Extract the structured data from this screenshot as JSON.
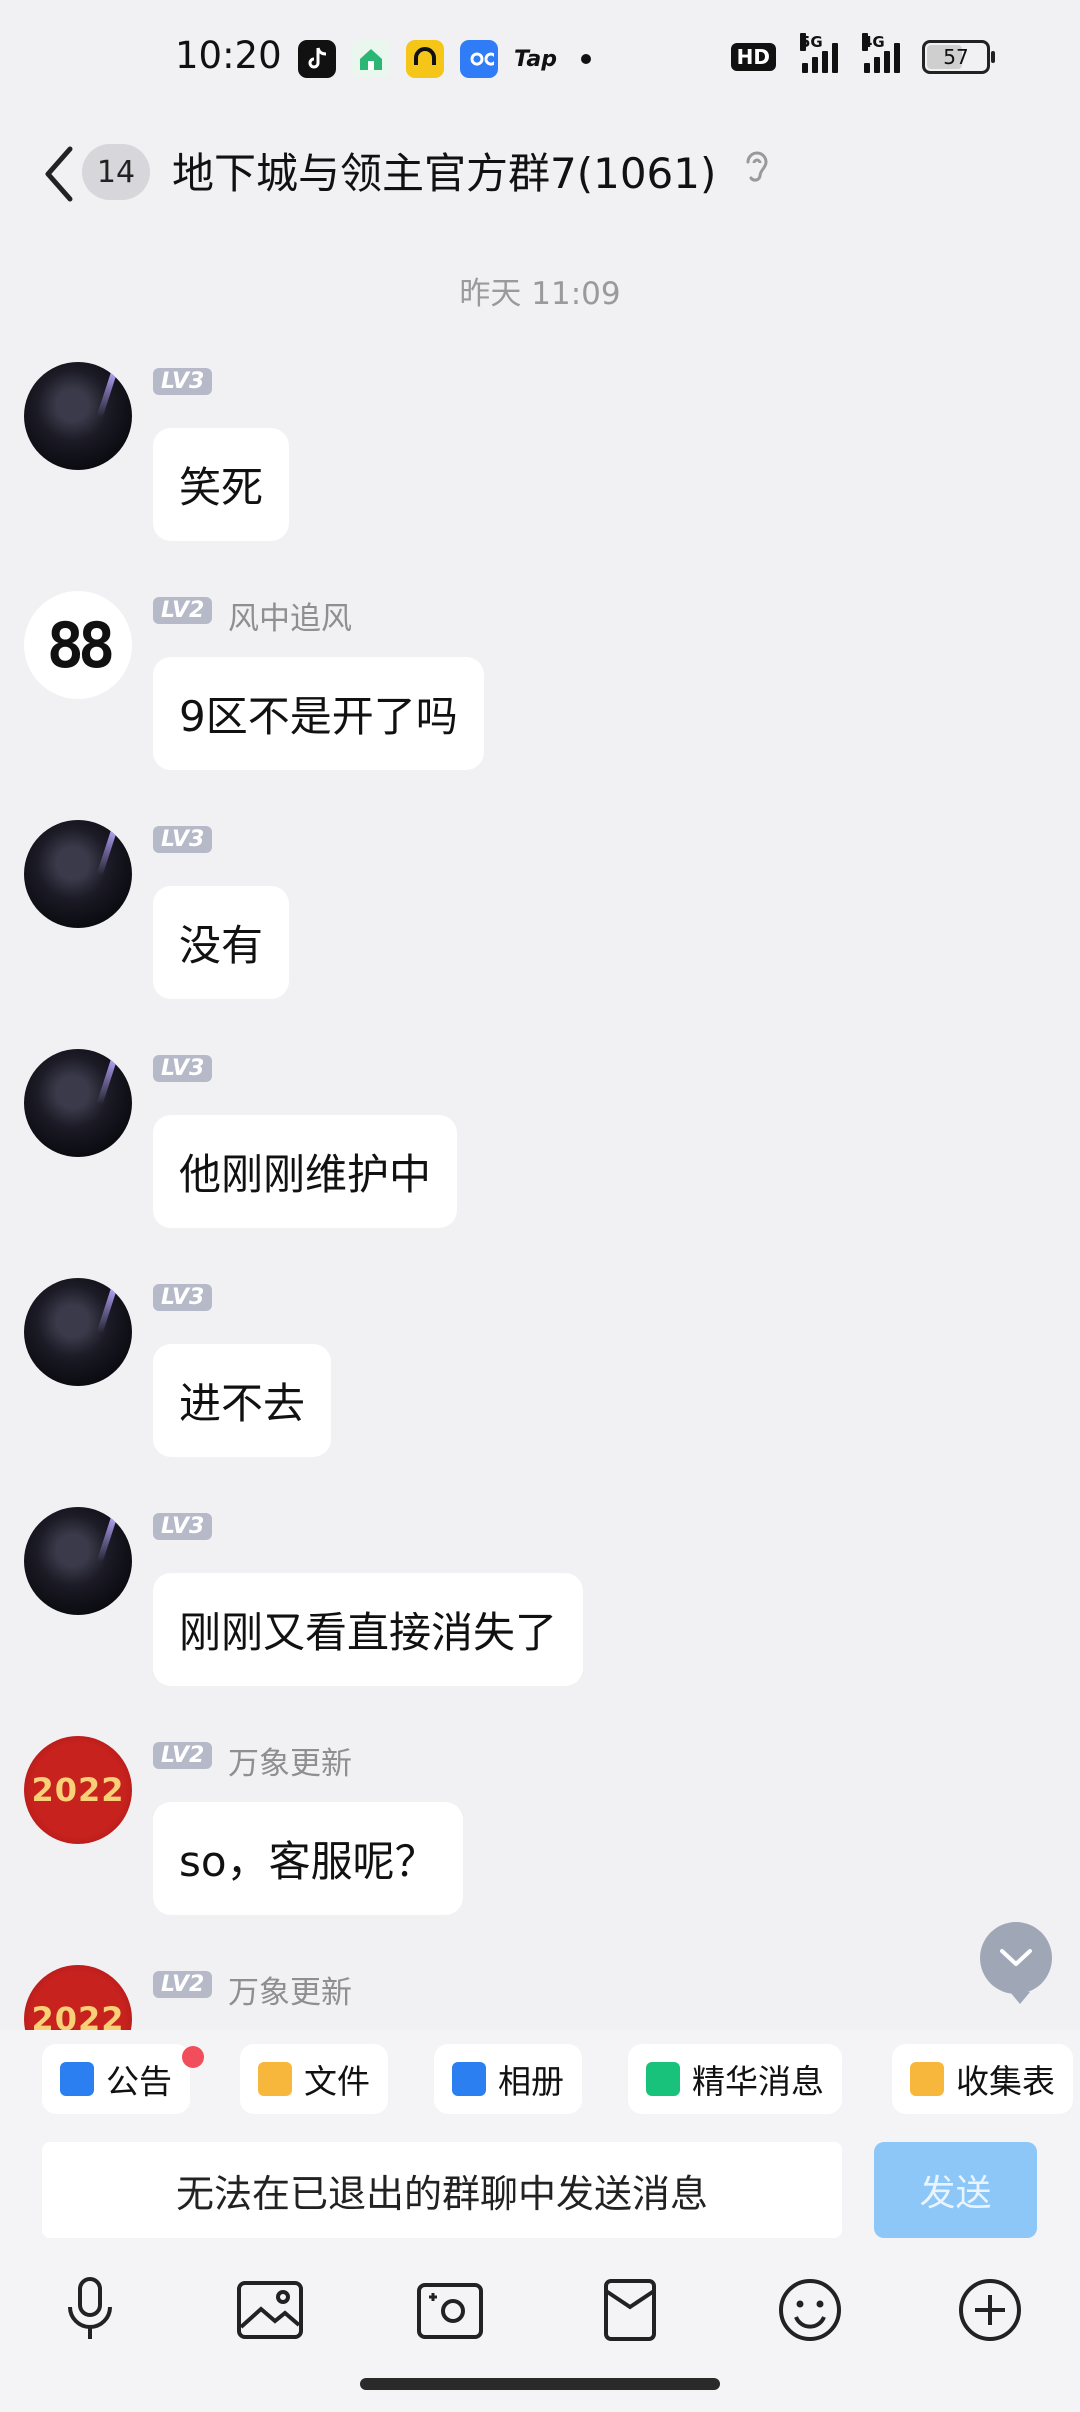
{
  "status_bar": {
    "time": "10:20",
    "apps": [
      {
        "icon": "tiktok-icon",
        "color": "#111111"
      },
      {
        "icon": "home-app-icon",
        "color": "#2bb673"
      },
      {
        "icon": "car-app-icon",
        "color": "#f5c518"
      },
      {
        "icon": "infinity-app-icon",
        "color": "#2f7cf6"
      },
      {
        "icon": "taptap-icon",
        "label": "Tap"
      }
    ],
    "hd_label": "HD",
    "signal_5g": "5G",
    "signal_4g": "4G",
    "battery_level": "57"
  },
  "header": {
    "unread_count": "14",
    "title": "地下城与领主官方群7(1061)"
  },
  "chat": {
    "timestamp": "昨天 11:09",
    "messages": [
      {
        "level": "LV3",
        "nickname": "",
        "text": "笑死",
        "avatar": "anime"
      },
      {
        "level": "LV2",
        "nickname": "风中追风",
        "text": "9区不是开了吗",
        "avatar": "digit"
      },
      {
        "level": "LV3",
        "nickname": "",
        "text": "没有",
        "avatar": "anime"
      },
      {
        "level": "LV3",
        "nickname": "",
        "text": "他刚刚维护中",
        "avatar": "anime"
      },
      {
        "level": "LV3",
        "nickname": "",
        "text": "进不去",
        "avatar": "anime"
      },
      {
        "level": "LV3",
        "nickname": "",
        "text": "刚刚又看直接消失了",
        "avatar": "anime"
      },
      {
        "level": "LV2",
        "nickname": "万象更新",
        "text": "so，客服呢？",
        "avatar": "tiger"
      },
      {
        "level": "LV2",
        "nickname": "万象更新",
        "text": "",
        "avatar": "tiger"
      }
    ],
    "digit_avatar_text": "88",
    "tiger_avatar_year": "2022"
  },
  "quick_bar": {
    "chips": [
      {
        "label": "公告",
        "icon": "announcement-icon",
        "color": "#2b7ff0"
      },
      {
        "label": "文件",
        "icon": "folder-icon",
        "color": "#f6b73c"
      },
      {
        "label": "相册",
        "icon": "album-icon",
        "color": "#2b7ff0"
      },
      {
        "label": "精华消息",
        "icon": "essence-icon",
        "color": "#19c27a"
      },
      {
        "label": "收集表",
        "icon": "form-icon",
        "color": "#f6b73c"
      }
    ]
  },
  "composer": {
    "disabled_text": "无法在已退出的群聊中发送消息",
    "send_label": "发送"
  },
  "toolbar": {
    "items": [
      "microphone-icon",
      "image-icon",
      "camera-icon",
      "red-packet-icon",
      "emoji-icon",
      "plus-icon"
    ]
  }
}
